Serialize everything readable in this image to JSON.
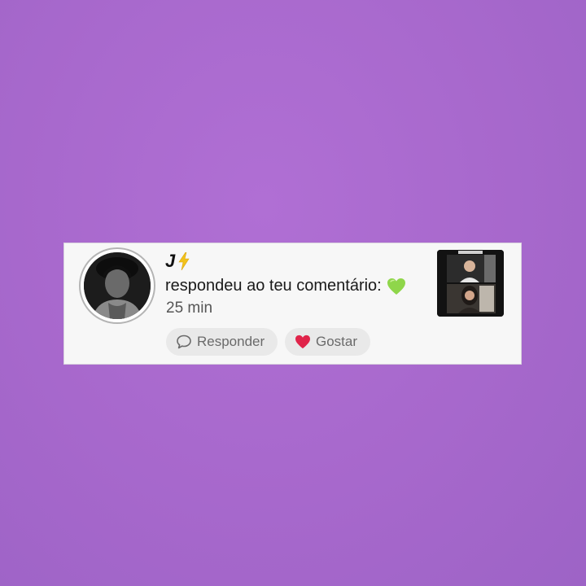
{
  "notification": {
    "username": "J",
    "message": "respondeu ao teu comentário:",
    "time": "25 min",
    "reply_label": "Responder",
    "like_label": "Gostar",
    "icons": {
      "badge": "lightning-bolt-icon",
      "message_emoji": "green-heart-icon",
      "reply": "speech-bubble-icon",
      "like": "red-heart-icon"
    },
    "colors": {
      "background": "#a96bcf",
      "card": "#f7f7f7",
      "like_heart": "#e0244a",
      "emoji_heart": "#8fd64a",
      "bolt": "#f2c21b"
    }
  }
}
